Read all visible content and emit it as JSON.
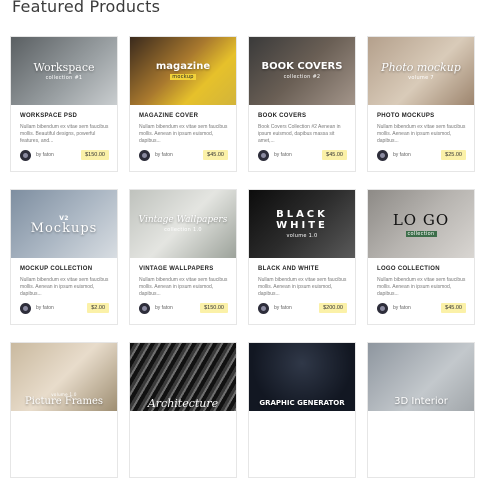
{
  "page": {
    "title": "Featured Products"
  },
  "products": [
    {
      "thumb_title": "Workspace",
      "thumb_sub": "collection #1",
      "title": "WORKSPACE PSD",
      "desc": "Nullam bibendum ex vitae sem faucibus mollis. Beautiful designs, powerful features, and...",
      "author": "by faton",
      "price": "$150.00"
    },
    {
      "thumb_title": "magazine",
      "thumb_sub": "mockup",
      "title": "MAGAZINE COVER",
      "desc": "Nullam bibendum ex vitae sem faucibus mollis. Aenean in ipsum euismod, dapibus...",
      "author": "by faton",
      "price": "$45.00"
    },
    {
      "thumb_title": "BOOK COVERS",
      "thumb_sub": "collection #2",
      "title": "BOOK COVERS",
      "desc": "Book Covers Collection #2 Aenean in ipsum euismod, dapibus massa sit amet,...",
      "author": "by faton",
      "price": "$45.00"
    },
    {
      "thumb_title": "Photo mockup",
      "thumb_sub": "volume 7",
      "title": "PHOTO MOCKUPS",
      "desc": "Nullam bibendum ex vitae sem faucibus mollis. Aenean in ipsum euismod, dapibus...",
      "author": "by faton",
      "price": "$25.00"
    },
    {
      "thumb_title": "Mockups",
      "thumb_sub": "V2",
      "title": "MOCKUP COLLECTION",
      "desc": "Nullam bibendum ex vitae sem faucibus mollis. Aenean in ipsum euismod, dapibus...",
      "author": "by faton",
      "price": "$2.00"
    },
    {
      "thumb_title": "Vintage Wallpapers",
      "thumb_sub": "collection 1.0",
      "title": "VINTAGE WALLPAPERS",
      "desc": "Nullam bibendum ex vitae sem faucibus mollis. Aenean in ipsum euismod, dapibus...",
      "author": "by faton",
      "price": "$150.00"
    },
    {
      "thumb_title": "BLACK WHITE",
      "thumb_sub": "volume 1.0",
      "title": "BLACK AND WHITE",
      "desc": "Nullam bibendum ex vitae sem faucibus mollis. Aenean in ipsum euismod, dapibus...",
      "author": "by faton",
      "price": "$200.00"
    },
    {
      "thumb_title": "LO GO",
      "thumb_sub": "collection",
      "title": "LOGO COLLECTION",
      "desc": "Nullam bibendum ex vitae sem faucibus mollis. Aenean in ipsum euismod, dapibus...",
      "author": "by faton",
      "price": "$45.00"
    },
    {
      "thumb_title": "Picture Frames",
      "thumb_sub": "volume 1.0",
      "title": "",
      "desc": "",
      "author": "",
      "price": ""
    },
    {
      "thumb_title": "Architecture",
      "thumb_sub": "",
      "title": "",
      "desc": "",
      "author": "",
      "price": ""
    },
    {
      "thumb_title": "GRAPHIC GENERATOR",
      "thumb_sub": "",
      "title": "",
      "desc": "",
      "author": "",
      "price": ""
    },
    {
      "thumb_title": "3D Interior",
      "thumb_sub": "",
      "title": "",
      "desc": "",
      "author": "",
      "price": ""
    }
  ]
}
